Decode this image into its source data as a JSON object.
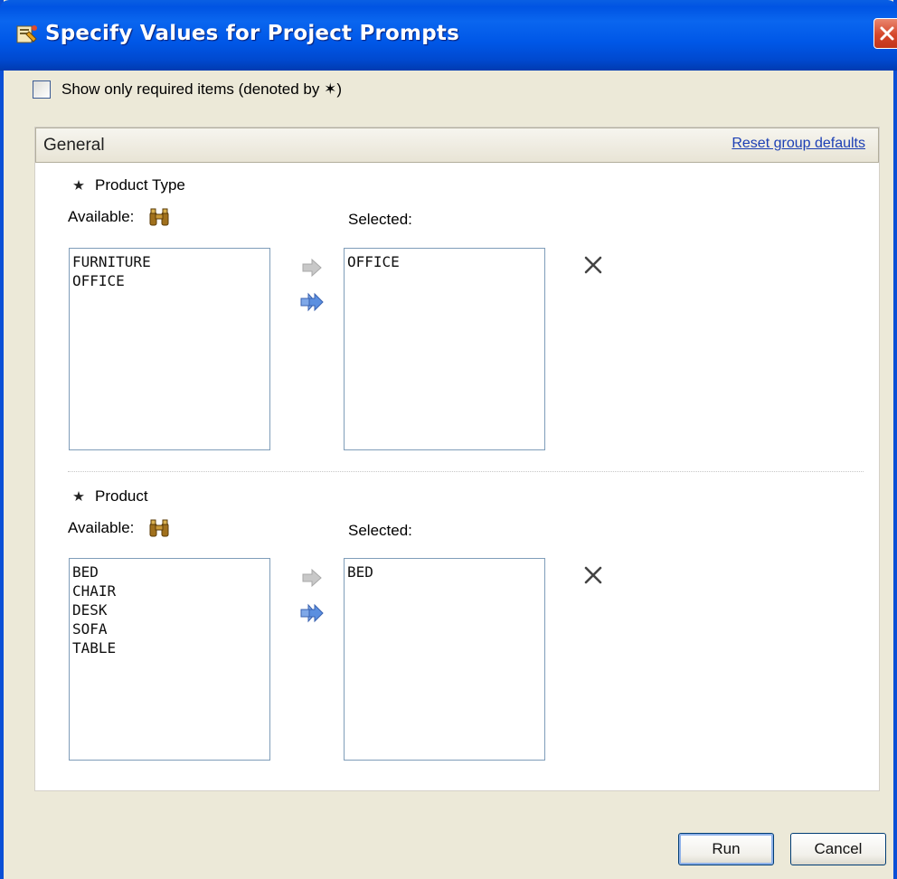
{
  "window": {
    "title": "Specify Values for Project Prompts"
  },
  "options": {
    "show_required_label": "Show only required items (denoted by ✶)",
    "show_required_checked": false
  },
  "group": {
    "title": "General",
    "reset_label": "Reset group defaults"
  },
  "prompts": [
    {
      "label": "Product Type",
      "available_label": "Available:",
      "selected_label": "Selected:",
      "available": [
        "FURNITURE",
        "OFFICE"
      ],
      "selected": [
        "OFFICE"
      ]
    },
    {
      "label": "Product",
      "available_label": "Available:",
      "selected_label": "Selected:",
      "available": [
        "BED",
        "CHAIR",
        "DESK",
        "SOFA",
        "TABLE"
      ],
      "selected": [
        "BED"
      ]
    }
  ],
  "buttons": {
    "run": "Run",
    "cancel": "Cancel"
  },
  "icons": {
    "window": "prompt-wizard-icon",
    "close": "close-icon",
    "required": "star-icon",
    "search": "binoculars-icon",
    "add": "arrow-right-icon",
    "add_all": "double-arrow-right-icon",
    "remove": "remove-x-icon"
  },
  "colors": {
    "titlebar": "#0054e3",
    "frame": "#ece9d8",
    "link": "#1c3fb4",
    "add_arrow": "#4a7fd6",
    "disabled_arrow": "#b5b5b5"
  }
}
